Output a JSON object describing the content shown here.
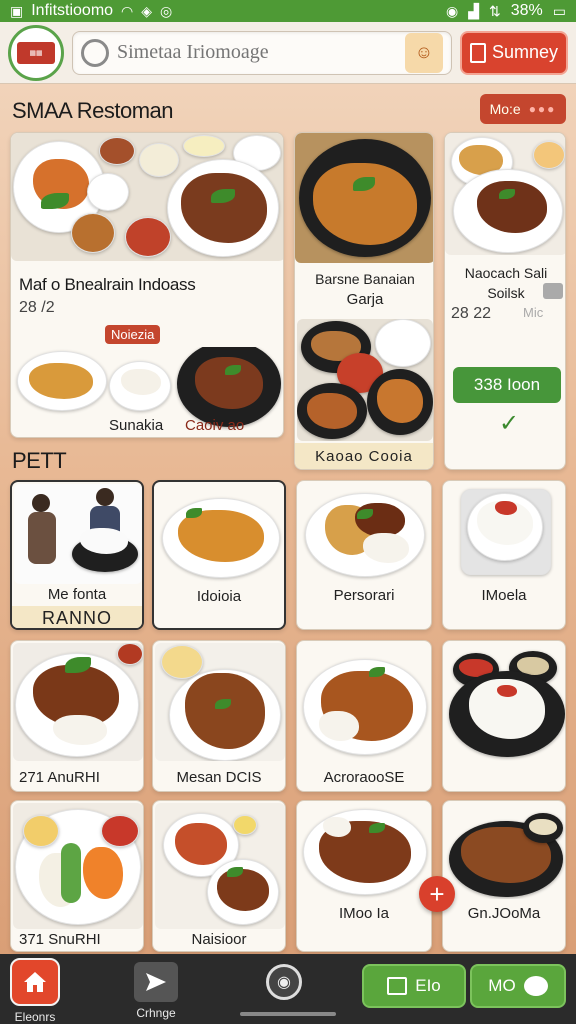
{
  "status_bar": {
    "carrier": "Infitstioomo",
    "battery": "38%"
  },
  "header": {
    "search_placeholder": "Simetaa Iriomoage",
    "summary_label": "Sumney"
  },
  "featured": {
    "title": "SMAA Restoman",
    "more_label": "Mo:e",
    "cards": [
      {
        "title": "Maf o Bnealrain Indoass",
        "price": "28 /2",
        "tag": "Noiezia",
        "labels": [
          "Sunakia",
          "Caoiv ao"
        ]
      },
      {
        "title": "Barsne Banaian",
        "subtitle": "Garja",
        "band": "Kaoao Cooia"
      },
      {
        "title": "Naocach Sali",
        "subtitle": "Soilsk",
        "price": "28 22",
        "side": "Mic",
        "button": "338 Ioon"
      }
    ]
  },
  "grid": {
    "title": "PETT",
    "items": [
      {
        "label": "Me fonta",
        "band": "RANNO"
      },
      {
        "label": "Idoioia"
      },
      {
        "label": "Persorari"
      },
      {
        "label": "IMoela"
      },
      {
        "label": "271 AnuRHI"
      },
      {
        "label": "Mesan DCIS"
      },
      {
        "label": "AcroraooSE"
      },
      {
        "label": ""
      },
      {
        "label": "371 SnuRHI"
      },
      {
        "label": "Naisioor"
      },
      {
        "label": "IMoo Ia"
      },
      {
        "label": "Gn.JOoMa"
      }
    ]
  },
  "bottom_nav": {
    "home_label": "Eleonrs",
    "share_label": "Crhnge",
    "left_action": "EIo",
    "right_action": "MO"
  },
  "colors": {
    "accent_red": "#d9432e",
    "accent_green": "#4e9a35",
    "background_peach": "#e8b995"
  }
}
